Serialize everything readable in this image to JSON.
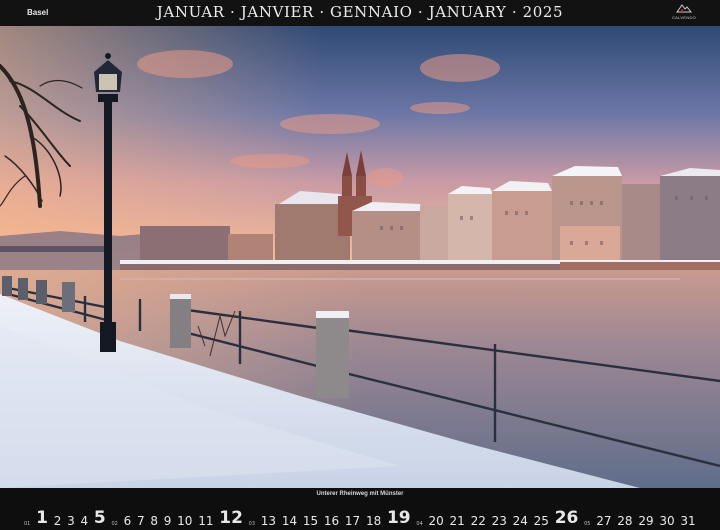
{
  "header": {
    "city": "Basel",
    "month_title": "JANUAR · JANVIER · GENNAIO · JANUARY · 2025",
    "logo_text": "CALVENDO"
  },
  "photo": {
    "caption": "Unterer Rheinweg mit Münster"
  },
  "calendar": {
    "entries": [
      {
        "kind": "week",
        "text": "01"
      },
      {
        "kind": "sunday",
        "text": "1"
      },
      {
        "kind": "day",
        "text": "2"
      },
      {
        "kind": "day",
        "text": "3"
      },
      {
        "kind": "day",
        "text": "4"
      },
      {
        "kind": "sunday",
        "text": "5"
      },
      {
        "kind": "week",
        "text": "02"
      },
      {
        "kind": "day",
        "text": "6"
      },
      {
        "kind": "day",
        "text": "7"
      },
      {
        "kind": "day",
        "text": "8"
      },
      {
        "kind": "day",
        "text": "9"
      },
      {
        "kind": "day",
        "text": "10"
      },
      {
        "kind": "day",
        "text": "11"
      },
      {
        "kind": "sunday",
        "text": "12"
      },
      {
        "kind": "week",
        "text": "03"
      },
      {
        "kind": "day",
        "text": "13"
      },
      {
        "kind": "day",
        "text": "14"
      },
      {
        "kind": "day",
        "text": "15"
      },
      {
        "kind": "day",
        "text": "16"
      },
      {
        "kind": "day",
        "text": "17"
      },
      {
        "kind": "day",
        "text": "18"
      },
      {
        "kind": "sunday",
        "text": "19"
      },
      {
        "kind": "week",
        "text": "04"
      },
      {
        "kind": "day",
        "text": "20"
      },
      {
        "kind": "day",
        "text": "21"
      },
      {
        "kind": "day",
        "text": "22"
      },
      {
        "kind": "day",
        "text": "23"
      },
      {
        "kind": "day",
        "text": "24"
      },
      {
        "kind": "day",
        "text": "25"
      },
      {
        "kind": "sunday",
        "text": "26"
      },
      {
        "kind": "week",
        "text": "05"
      },
      {
        "kind": "day",
        "text": "27"
      },
      {
        "kind": "day",
        "text": "28"
      },
      {
        "kind": "day",
        "text": "29"
      },
      {
        "kind": "day",
        "text": "30"
      },
      {
        "kind": "day",
        "text": "31"
      }
    ]
  }
}
